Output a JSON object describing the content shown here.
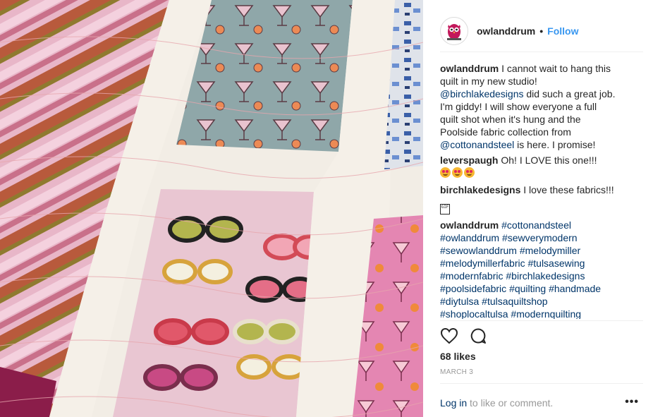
{
  "post": {
    "author": "owlanddrum",
    "separator": "•",
    "follow_label": "Follow"
  },
  "comments": {
    "caption": {
      "user": "owlanddrum",
      "text_1": " I cannot wait to hang this quilt in my new studio! ",
      "mention_1": "@birchlakedesigns",
      "text_2": " did such a great job. I'm giddy! I will show everyone a full quilt shot when it's hung and the Poolside fabric collection from ",
      "mention_2": "@cottonandsteel",
      "text_3": " is here. I promise!"
    },
    "c1": {
      "user": "leverspaugh",
      "text": " Oh! I LOVE this one!!!"
    },
    "c2": {
      "user": "birchlakedesigns",
      "text": " I love these fabrics!!!",
      "gif_glyph": "GIF"
    },
    "c3": {
      "user": "owlanddrum",
      "tags": [
        "#cottonandsteel",
        "#owlanddrum",
        "#sewverymodern",
        "#sewowlanddrum",
        "#melodymiller",
        "#melodymillerfabric",
        "#tulsasewing",
        "#modernfabric",
        "#birchlakedesigns",
        "#poolsidefabric",
        "#quilting",
        "#handmade",
        "#diytulsa",
        "#tulsaquiltshop",
        "#shoplocaltulsa",
        "#modernquilting"
      ]
    }
  },
  "icons": {
    "like": "heart-outline-icon",
    "comment": "comment-bubble-icon",
    "more": "more-options-icon"
  },
  "footer": {
    "likes": "68 likes",
    "date": "MARCH 3",
    "login_link": "Log in",
    "login_rest": " to like or comment.",
    "more": "•••"
  },
  "colors": {
    "link_blue": "#3897f0",
    "mention_navy": "#003569",
    "text": "#262626",
    "muted": "#999999"
  }
}
